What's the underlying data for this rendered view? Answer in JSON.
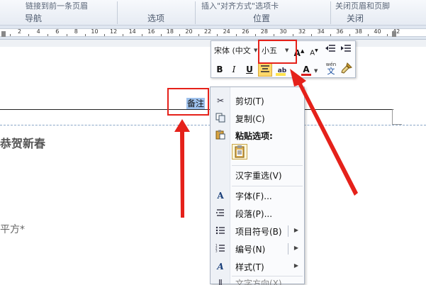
{
  "ribbon": {
    "top_items": [
      "链接到前一条页眉",
      "插入\"对齐方式\"选项卡",
      "关闭页眉和页脚"
    ],
    "groups": [
      {
        "label": "导航"
      },
      {
        "label": "选项"
      },
      {
        "label": "位置"
      },
      {
        "label": "关闭"
      }
    ]
  },
  "ruler": {
    "ticks": [
      "2",
      "4",
      "6",
      "8",
      "10",
      "12",
      "14",
      "16",
      "18",
      "20",
      "22",
      "24",
      "26",
      "28",
      "30",
      "32",
      "34",
      "36",
      "38",
      "40",
      "42"
    ]
  },
  "document": {
    "selected_text": "备注",
    "heading_text": "恭贺新春",
    "body_text": "平方*"
  },
  "mini_toolbar": {
    "font_name": "宋体 (中文",
    "font_size": "小五",
    "bold": "B",
    "italic": "I",
    "underline": "U",
    "font_color_letter": "A",
    "phonetic_top": "wén",
    "phonetic_bottom": "文"
  },
  "context_menu": {
    "cut": "剪切(T)",
    "copy": "复制(C)",
    "paste_options": "粘贴选项:",
    "reconvert": "汉字重选(V)",
    "font": "字体(F)...",
    "paragraph": "段落(P)...",
    "bullets": "项目符号(B)",
    "numbering": "编号(N)",
    "styles": "样式(T)",
    "more": "文字方向(X)..."
  },
  "colors": {
    "annotation_red": "#e5211a",
    "selection_blue": "#9ec1ec",
    "highlight_yellow": "#ffe34d",
    "font_red": "#d81e1e"
  }
}
